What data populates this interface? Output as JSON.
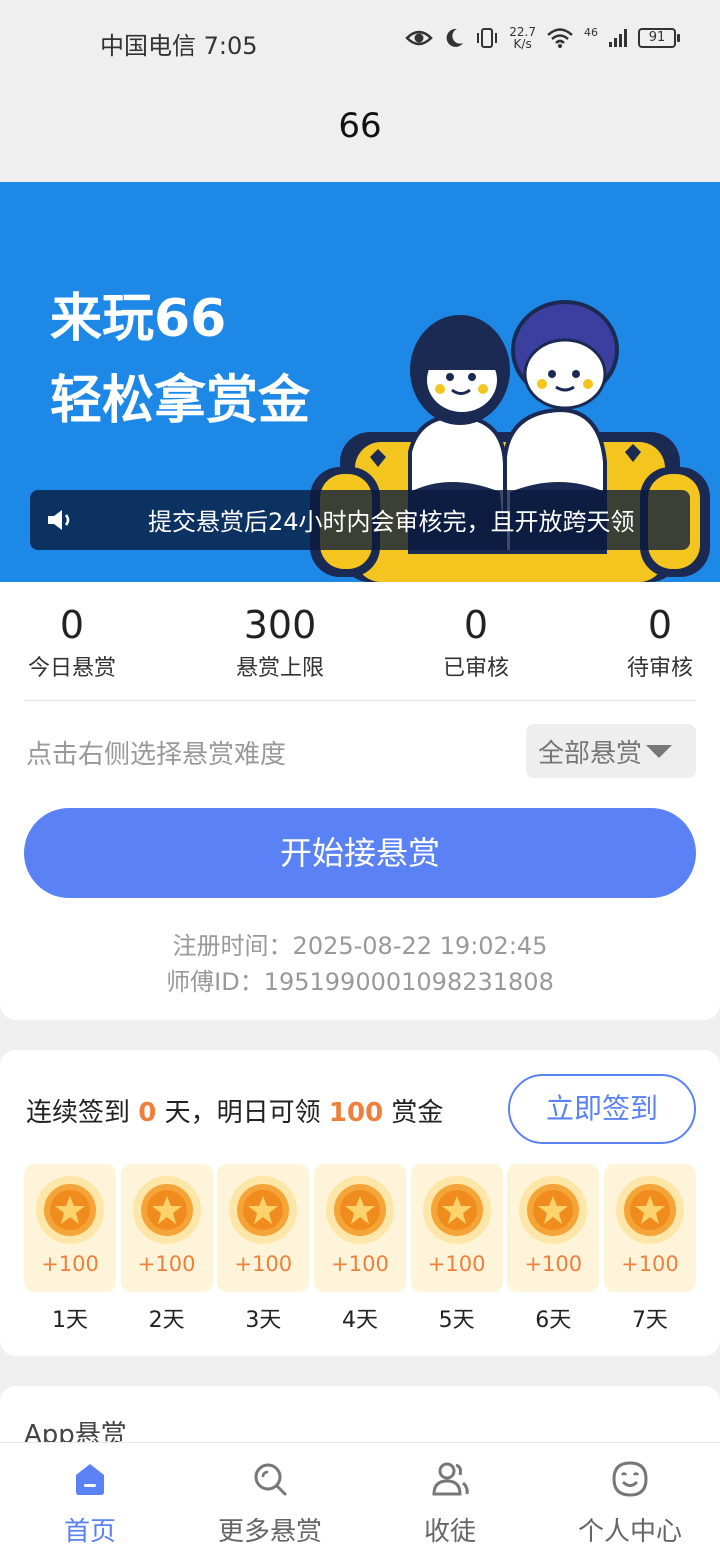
{
  "status_bar": {
    "carrier_time": "中国电信 7:05",
    "net_speed_value": "22.7",
    "net_speed_unit": "K/s",
    "signal_type": "46",
    "battery": "91"
  },
  "header": {
    "title": "66"
  },
  "banner": {
    "headline_line1": "来玩66",
    "headline_line2": "轻松拿赏金",
    "notice_text": "提交悬赏后24小时内会审核完，且开放跨天领"
  },
  "stats": [
    {
      "value": "0",
      "label": "今日悬赏"
    },
    {
      "value": "300",
      "label": "悬赏上限"
    },
    {
      "value": "0",
      "label": "已审核"
    },
    {
      "value": "0",
      "label": "待审核"
    }
  ],
  "filter": {
    "hint": "点击右侧选择悬赏难度",
    "selected": "全部悬赏"
  },
  "start_button": "开始接悬赏",
  "account": {
    "register_time": "注册时间：2025-08-22 19:02:45",
    "master_id": "师傅ID：1951990001098231808"
  },
  "checkin": {
    "prefix": "连续签到 ",
    "streak_days": "0",
    "middle": " 天，明日可领 ",
    "reward": "100",
    "suffix": " 赏金",
    "button": "立即签到",
    "days": [
      {
        "reward": "+100",
        "label": "1天"
      },
      {
        "reward": "+100",
        "label": "2天"
      },
      {
        "reward": "+100",
        "label": "3天"
      },
      {
        "reward": "+100",
        "label": "4天"
      },
      {
        "reward": "+100",
        "label": "5天"
      },
      {
        "reward": "+100",
        "label": "6天"
      },
      {
        "reward": "+100",
        "label": "7天"
      }
    ]
  },
  "section_peek": {
    "title": "App悬赏"
  },
  "bottom_nav": [
    {
      "label": "首页",
      "icon": "home-icon",
      "active": true
    },
    {
      "label": "更多悬赏",
      "icon": "search-icon",
      "active": false
    },
    {
      "label": "收徒",
      "icon": "users-icon",
      "active": false
    },
    {
      "label": "个人中心",
      "icon": "face-icon",
      "active": false
    }
  ],
  "colors": {
    "primary": "#5b82f4",
    "banner_bg": "#1e88e6",
    "accent_orange": "#f07f3b",
    "coin_bg": "#fdf4d9"
  }
}
